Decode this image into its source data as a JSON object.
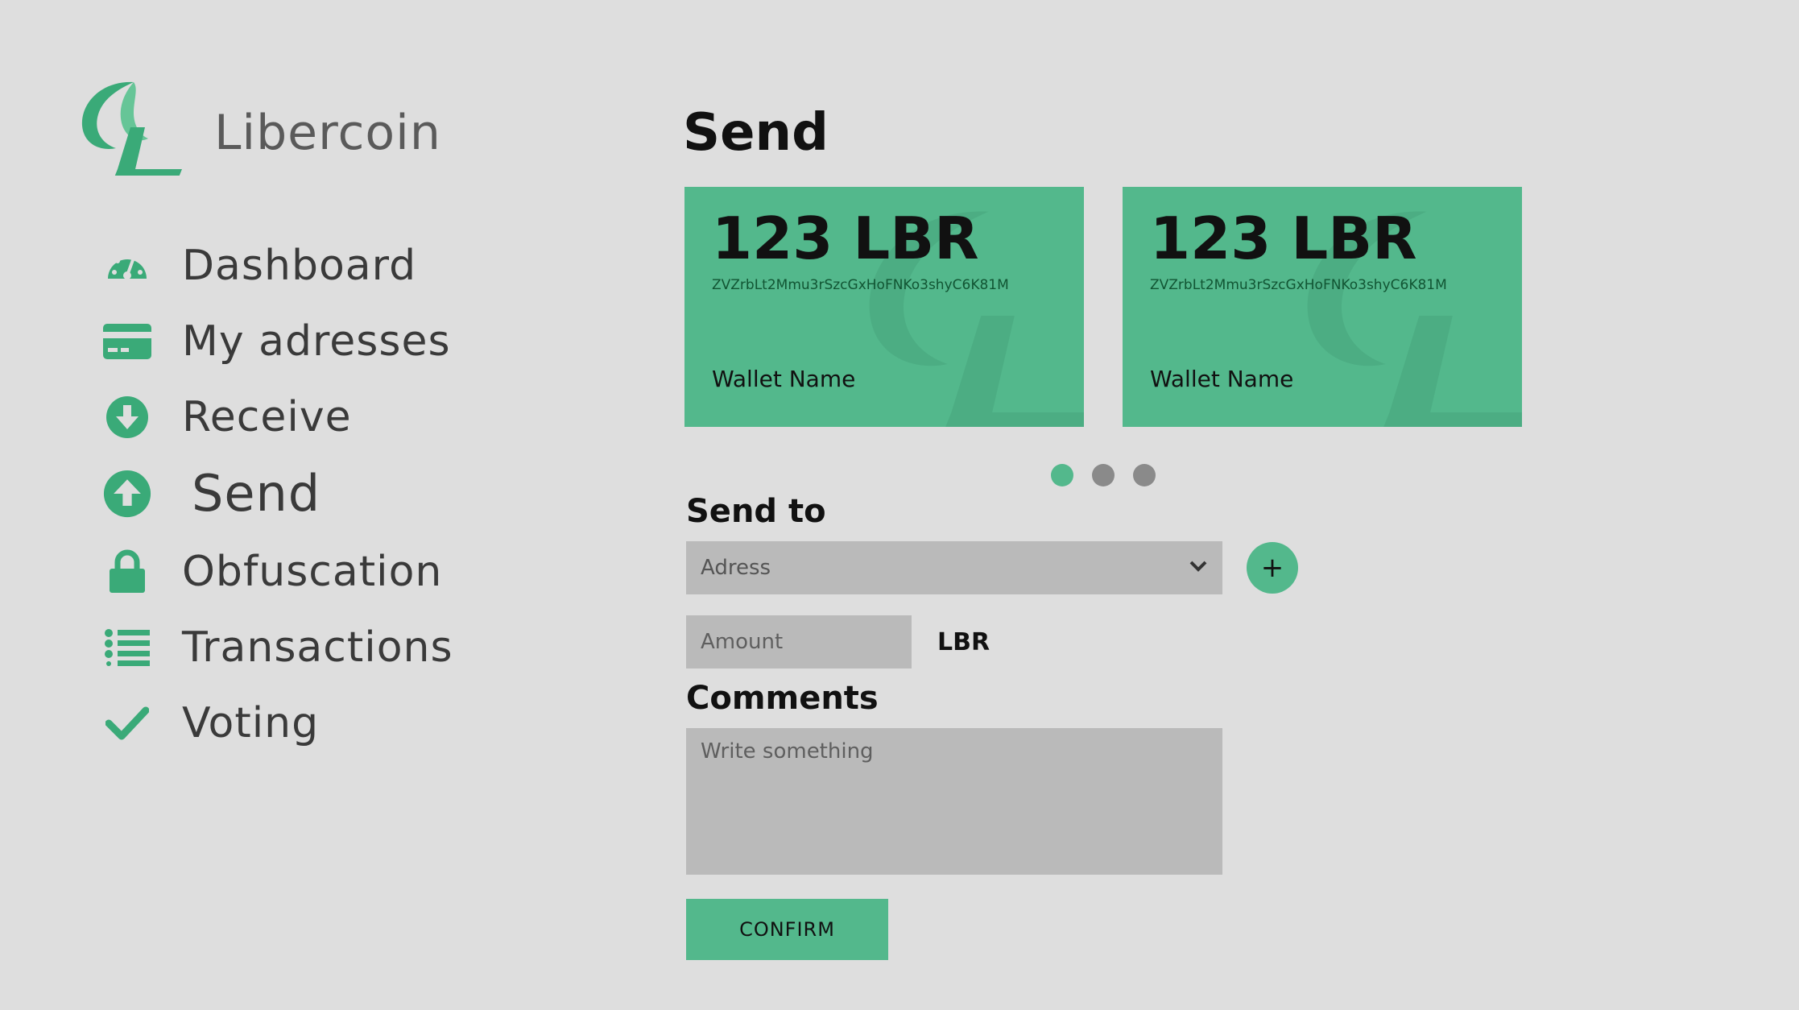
{
  "brand": {
    "name": "Libercoin",
    "accent_color": "#53b88c",
    "logo_icon": "libercoin-logo-icon"
  },
  "sidebar": {
    "items": [
      {
        "label": "Dashboard",
        "icon": "speedometer-icon"
      },
      {
        "label": "My adresses",
        "icon": "credit-card-icon"
      },
      {
        "label": "Receive",
        "icon": "arrow-down-circle-icon"
      },
      {
        "label": "Send",
        "icon": "arrow-up-circle-icon",
        "active": true
      },
      {
        "label": "Obfuscation",
        "icon": "lock-icon"
      },
      {
        "label": "Transactions",
        "icon": "list-icon"
      },
      {
        "label": "Voting",
        "icon": "checkmark-icon"
      }
    ]
  },
  "main": {
    "title": "Send",
    "wallets": [
      {
        "amount": "123 LBR",
        "address": "ZVZrbLt2Mmu3rSzcGxHoFNKo3shyC6K81M",
        "name": "Wallet Name"
      },
      {
        "amount": "123 LBR",
        "address": "ZVZrbLt2Mmu3rSzcGxHoFNKo3shyC6K81M",
        "name": "Wallet Name"
      }
    ],
    "carousel": {
      "pages": 3,
      "active_page": 1
    },
    "send_to": {
      "label": "Send to",
      "address_select_value": "Adress",
      "add_button_label": "+"
    },
    "amount": {
      "placeholder": "Amount",
      "currency": "LBR"
    },
    "comments": {
      "label": "Comments",
      "placeholder": "Write something"
    },
    "confirm_label": "CONFIRM"
  }
}
